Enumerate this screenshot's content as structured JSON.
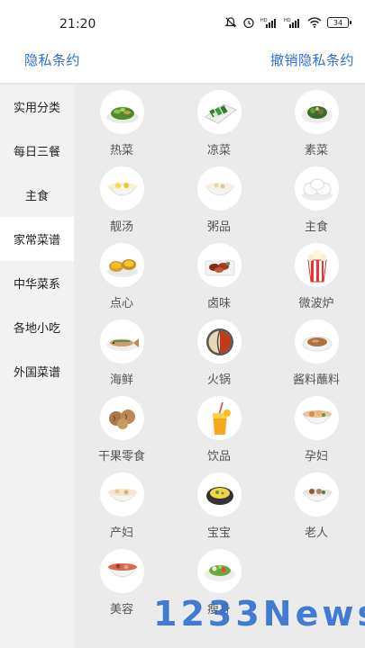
{
  "status_bar": {
    "time": "21:20",
    "battery": "34",
    "icons": [
      "mute-icon",
      "alarm-icon",
      "hd-signal-icon",
      "hd-signal-icon",
      "wifi-icon",
      "battery-icon"
    ]
  },
  "top_bar": {
    "left_label": "隐私条约",
    "right_label": "撤销隐私条约",
    "accent_color": "#2f6fd0"
  },
  "sidebar": {
    "items": [
      {
        "label": "实用分类"
      },
      {
        "label": "每日三餐"
      },
      {
        "label": "主食"
      },
      {
        "label": "家常菜谱",
        "active": true
      },
      {
        "label": "中华菜系"
      },
      {
        "label": "各地小吃"
      },
      {
        "label": "外国菜谱"
      }
    ]
  },
  "grid": {
    "items": [
      {
        "label": "热菜",
        "icon": "stir-fry-greens-icon"
      },
      {
        "label": "凉菜",
        "icon": "cucumber-salad-icon"
      },
      {
        "label": "素菜",
        "icon": "vegetable-plate-icon"
      },
      {
        "label": "靓汤",
        "icon": "soup-bowl-icon"
      },
      {
        "label": "粥品",
        "icon": "porridge-icon"
      },
      {
        "label": "主食",
        "icon": "steamed-buns-icon"
      },
      {
        "label": "点心",
        "icon": "egg-tart-icon"
      },
      {
        "label": "卤味",
        "icon": "braised-meat-icon"
      },
      {
        "label": "微波炉",
        "icon": "popcorn-icon"
      },
      {
        "label": "海鲜",
        "icon": "fish-dish-icon"
      },
      {
        "label": "火锅",
        "icon": "hotpot-icon"
      },
      {
        "label": "酱料蘸料",
        "icon": "sauce-dish-icon"
      },
      {
        "label": "干果零食",
        "icon": "walnuts-icon"
      },
      {
        "label": "饮品",
        "icon": "juice-glass-icon"
      },
      {
        "label": "孕妇",
        "icon": "nourishing-soup-icon"
      },
      {
        "label": "产妇",
        "icon": "postpartum-soup-icon"
      },
      {
        "label": "宝宝",
        "icon": "baby-egg-custard-icon"
      },
      {
        "label": "老人",
        "icon": "elder-soup-icon"
      },
      {
        "label": "美容",
        "icon": "beauty-dessert-icon"
      },
      {
        "label": "瘦身",
        "icon": "salad-icon"
      }
    ]
  },
  "watermark": "1233News"
}
